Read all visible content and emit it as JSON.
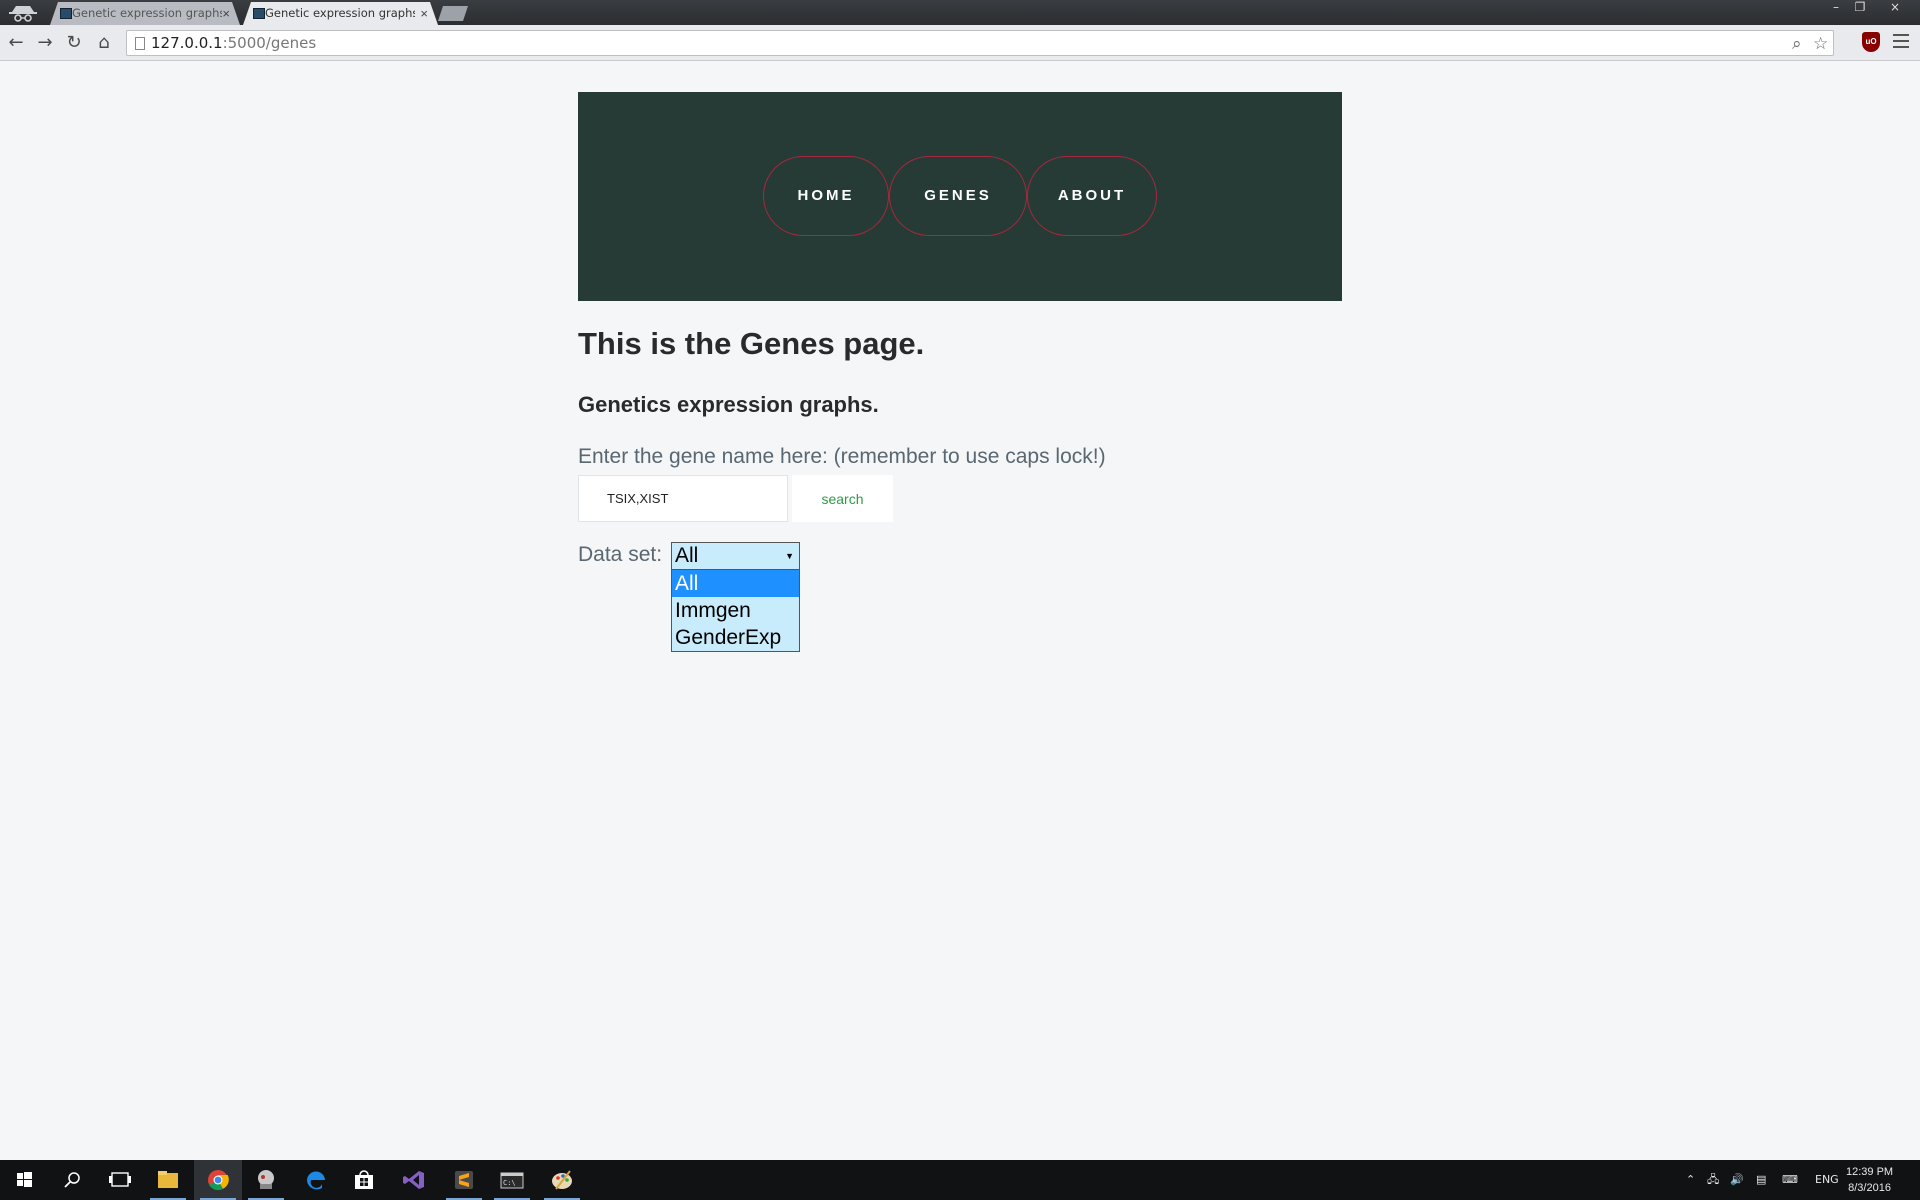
{
  "browser": {
    "tabs": [
      {
        "title": "Genetic expression graphs",
        "close": "×",
        "state": "inactive"
      },
      {
        "title": "Genetic expression graphs",
        "close": "×",
        "state": "active"
      }
    ],
    "url_host": "127.0.0.1",
    "url_path": ":5000/genes",
    "window_controls": {
      "minimize": "–",
      "restore": "❐",
      "close": "×"
    },
    "ublock_label": "uO"
  },
  "site": {
    "nav": [
      {
        "label": "HOME"
      },
      {
        "label": "GENES"
      },
      {
        "label": "ABOUT"
      }
    ],
    "heading": "This is the Genes page.",
    "subheading": "Genetics expression graphs.",
    "prompt": "Enter the gene name here: (remember to use caps lock!)",
    "gene_input_value": "TSIX,XIST",
    "search_label": "search",
    "dataset_label": "Data set:",
    "dataset_selected": "All",
    "dataset_options": [
      "All",
      "Immgen",
      "GenderExp"
    ]
  },
  "colors": {
    "banner": "#263b36",
    "nav_border": "#a5283d",
    "search_text": "#2e9c46",
    "select_bg": "#c8ecfb",
    "option_highlight": "#1e90ff"
  },
  "taskbar": {
    "apps": [
      "windows-start-icon",
      "search-icon",
      "task-view-icon",
      "file-explorer-icon",
      "chrome-icon",
      "app-icon",
      "edge-icon",
      "store-icon",
      "visual-studio-icon",
      "sublime-icon",
      "terminal-icon",
      "paint-icon"
    ],
    "lang": "ENG",
    "time": "12:39 PM",
    "date": "8/3/2016"
  }
}
